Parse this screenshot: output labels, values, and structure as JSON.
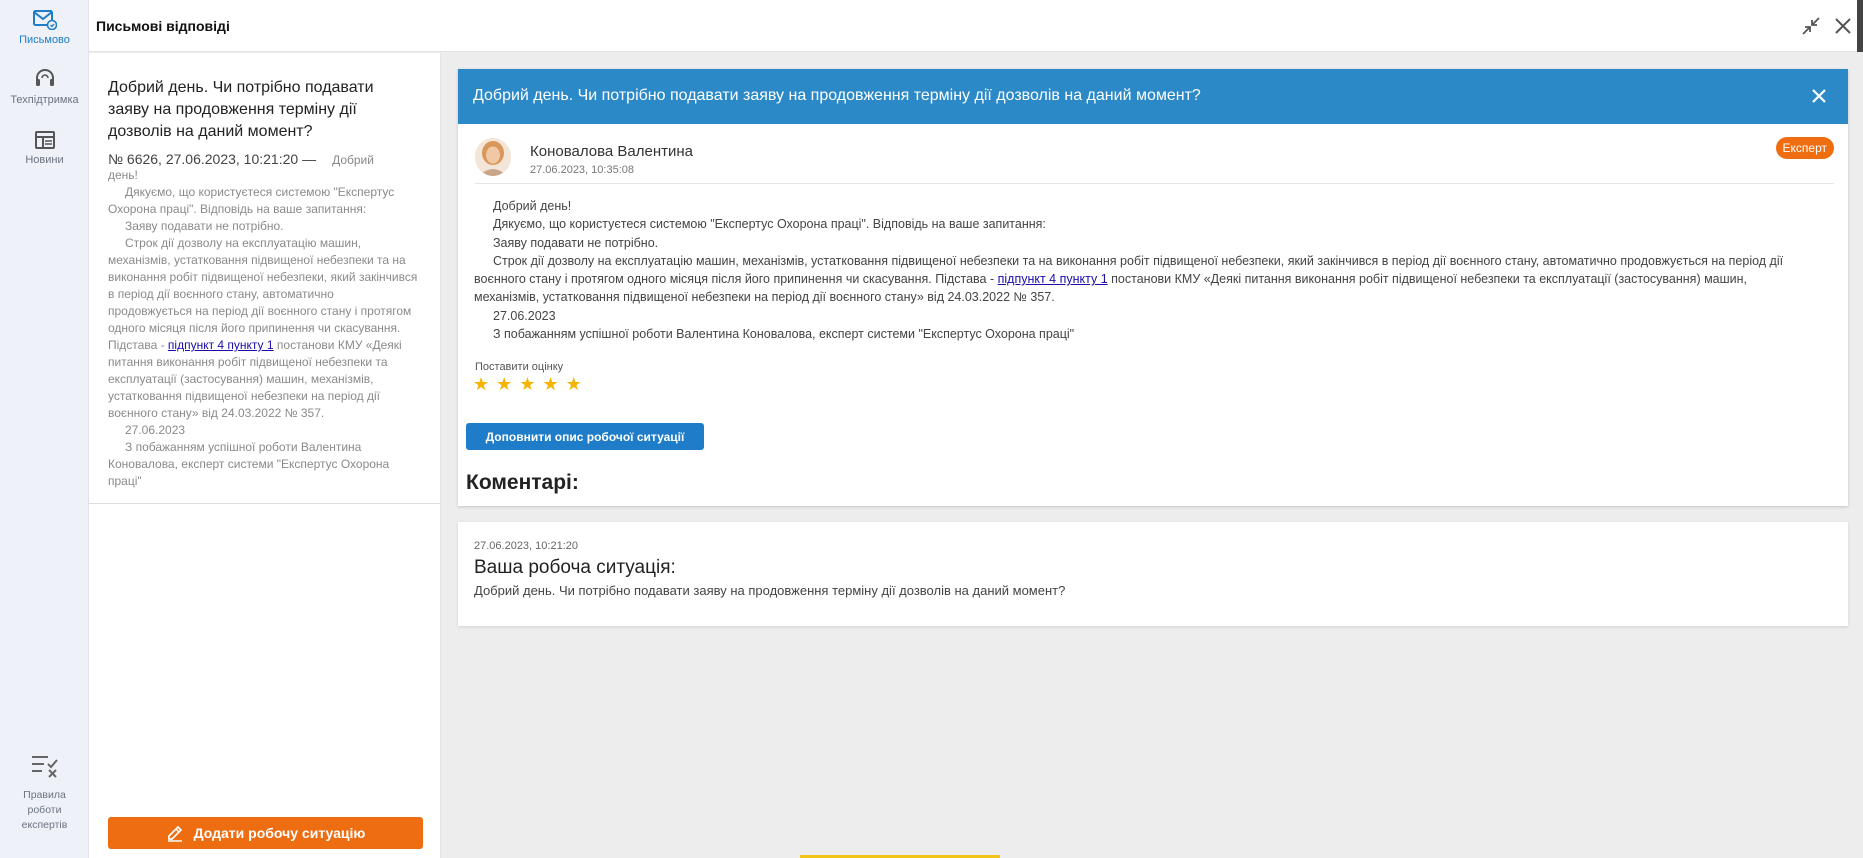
{
  "rail": {
    "items": [
      {
        "label": "Письмово"
      },
      {
        "label": "Техпідтримка"
      },
      {
        "label": "Новини"
      }
    ],
    "rules_label_lines": [
      "Правила",
      "роботи",
      "експертів"
    ]
  },
  "header": {
    "title": "Письмові відповіді"
  },
  "list": {
    "item": {
      "title": "Добрий день. Чи потрібно подавати заяву на продовження терміну дії дозволів на даний момент?",
      "meta": "№ 6626, 27.06.2023, 10:21:20 —",
      "meta_tail": "Добрий",
      "greeting_tail": "день!",
      "p1": "Дякуємо, що користуєтеся системою \"Експертус Охорона праці\". Відповідь на ваше запитання:",
      "p2": "Заяву подавати не потрібно.",
      "p3_before": "Строк дії дозволу на експлуатацію машин, механізмів, устатковання підвищеної небезпеки та на виконання робіт підвищеної небезпеки, який закінчився в період дії воєнного стану, автоматично продовжується на період дії воєнного стану і протягом одного місяця після його припинення чи скасування. Підстава - ",
      "p3_link": "підпункт 4 пункту 1",
      "p3_after": " постанови КМУ «Деякі питання виконання робіт підвищеної небезпеки та експлуатації (застосування) машин, механізмів, устатковання підвищеної небезпеки на період дії воєнного стану» від 24.03.2022 № 357.",
      "date": "27.06.2023",
      "sign": "З побажанням успішної роботи Валентина Коновалова, експерт системи \"Експертус Охорона праці\""
    },
    "add_button": "Додати робочу ситуацію"
  },
  "detail": {
    "title": "Добрий день. Чи потрібно подавати заяву на продовження терміну дії дозволів на даний момент?",
    "author": "Коновалова Валентина",
    "author_date": "27.06.2023, 10:35:08",
    "badge": "Експерт",
    "answer": {
      "greeting": "Добрий день!",
      "p1": "Дякуємо, що користуєтеся системою \"Експертус Охорона праці\". Відповідь на ваше запитання:",
      "p2": "Заяву подавати не потрібно.",
      "p3_before": "Строк дії дозволу на експлуатацію машин, механізмів, устатковання підвищеної небезпеки та на виконання робіт підвищеної небезпеки, який закінчився в період дії воєнного стану, автоматично продовжується на період дії воєнного стану і протягом одного місяця після його припинення чи скасування. Підстава - ",
      "p3_link": "підпункт 4 пункту 1",
      "p3_after": " постанови КМУ «Деякі питання виконання робіт підвищеної небезпеки та експлуатації (застосування) машин, механізмів, устатковання підвищеної небезпеки на період дії воєнного стану» від 24.03.2022 № 357.",
      "date": "27.06.2023",
      "sign": "З побажанням успішної роботи Валентина Коновалова, експерт системи \"Експертус Охорона праці\""
    },
    "rating_label": "Поставити оцінку",
    "stars": [
      "★",
      "★",
      "★",
      "★",
      "★"
    ],
    "supplement_button": "Доповнити опис робочої ситуації",
    "comments_title": "Коментарі:"
  },
  "situation": {
    "date": "27.06.2023, 10:21:20",
    "heading": "Ваша робоча ситуація:",
    "text": "Добрий день. Чи потрібно подавати заяву на продовження терміну дії дозволів на даний момент?"
  },
  "colors": {
    "accent_blue": "#2b89c8",
    "button_blue": "#1e7cc8",
    "accent_orange": "#ee6d10",
    "star": "#f6b400"
  }
}
